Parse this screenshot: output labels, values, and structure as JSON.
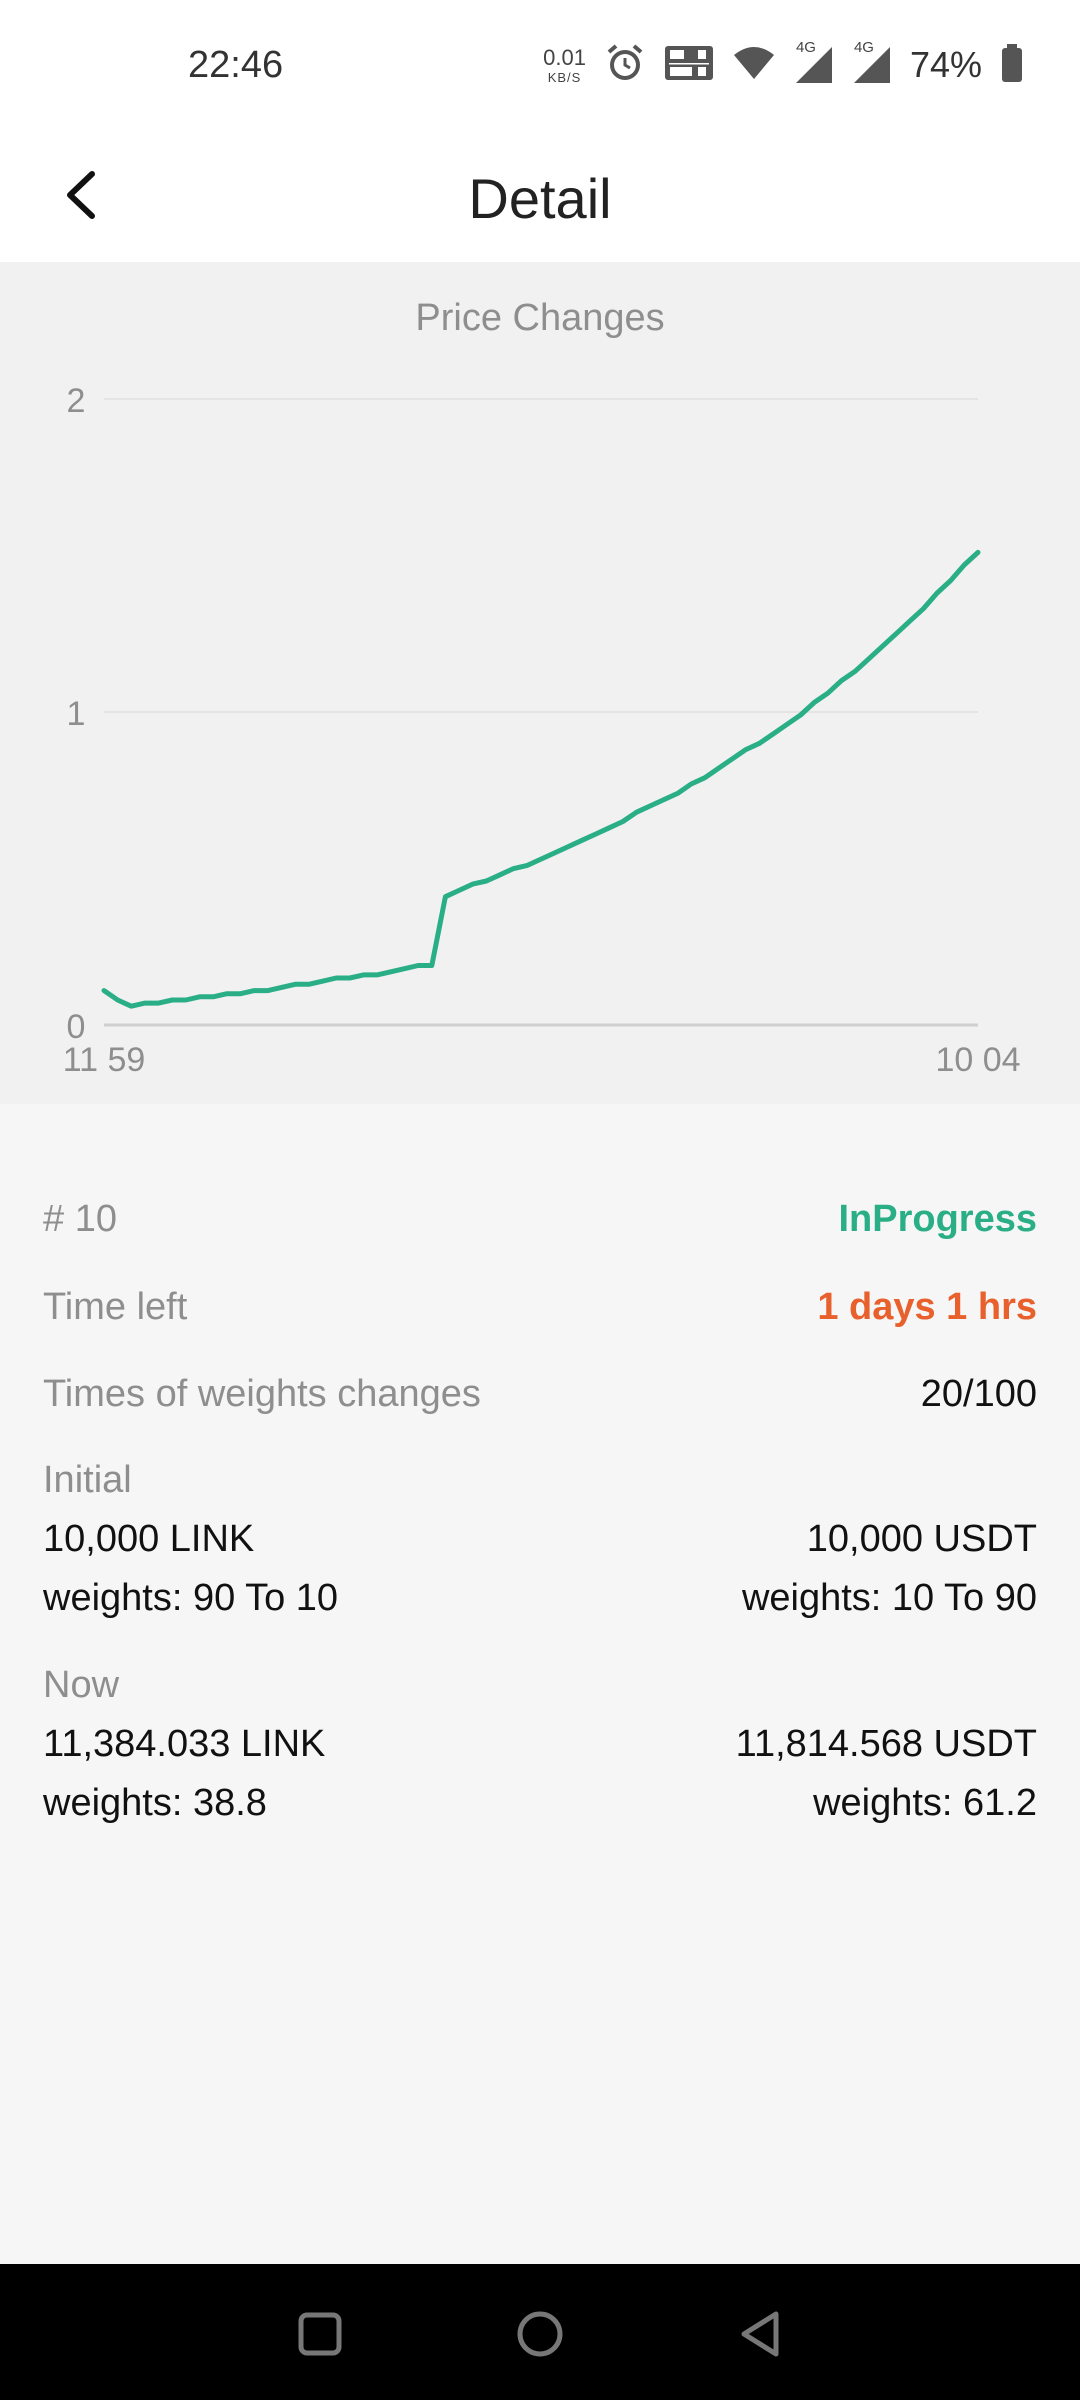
{
  "status_bar": {
    "time": "22:46",
    "net_speed_value": "0.01",
    "net_speed_unit": "KB/S",
    "signal_1": "4G",
    "signal_2": "4G",
    "battery": "74%",
    "icons": [
      "alarm-icon",
      "volte-icon",
      "wifi-icon",
      "signal-icon",
      "signal-icon",
      "battery-icon"
    ]
  },
  "header": {
    "title": "Detail",
    "back_icon": "chevron-left-icon"
  },
  "chart_data": {
    "type": "line",
    "title": "Price Changes",
    "xlabel": "",
    "ylabel": "",
    "x_tick_labels": [
      "11 59",
      "10 04"
    ],
    "y_ticks": [
      0,
      1,
      2
    ],
    "ylim": [
      0,
      2
    ],
    "grid": true,
    "series": [
      {
        "color": "#2aae86",
        "values": [
          0.11,
          0.08,
          0.06,
          0.07,
          0.07,
          0.08,
          0.08,
          0.09,
          0.09,
          0.1,
          0.1,
          0.11,
          0.11,
          0.12,
          0.13,
          0.13,
          0.14,
          0.15,
          0.15,
          0.16,
          0.16,
          0.17,
          0.18,
          0.19,
          0.19,
          0.41,
          0.43,
          0.45,
          0.46,
          0.48,
          0.5,
          0.51,
          0.53,
          0.55,
          0.57,
          0.59,
          0.61,
          0.63,
          0.65,
          0.68,
          0.7,
          0.72,
          0.74,
          0.77,
          0.79,
          0.82,
          0.85,
          0.88,
          0.9,
          0.93,
          0.96,
          0.99,
          1.03,
          1.06,
          1.1,
          1.13,
          1.17,
          1.21,
          1.25,
          1.29,
          1.33,
          1.38,
          1.42,
          1.47,
          1.51
        ]
      }
    ]
  },
  "details": {
    "id": "# 10",
    "status": "InProgress",
    "time_left_label": "Time left",
    "time_left_value": "1 days 1 hrs",
    "weights_changes_label": "Times of weights changes",
    "weights_changes_value": "20/100",
    "initial_label": "Initial",
    "initial_left_amount": "10,000 LINK",
    "initial_left_weights": "weights: 90 To 10",
    "initial_right_amount": "10,000 USDT",
    "initial_right_weights": "weights: 10 To 90",
    "now_label": "Now",
    "now_left_amount": "11,384.033 LINK",
    "now_left_weights": "weights: 38.8",
    "now_right_amount": "11,814.568 USDT",
    "now_right_weights": "weights: 61.2"
  },
  "colors": {
    "accent_green": "#2aae86",
    "accent_orange": "#e8602c"
  }
}
